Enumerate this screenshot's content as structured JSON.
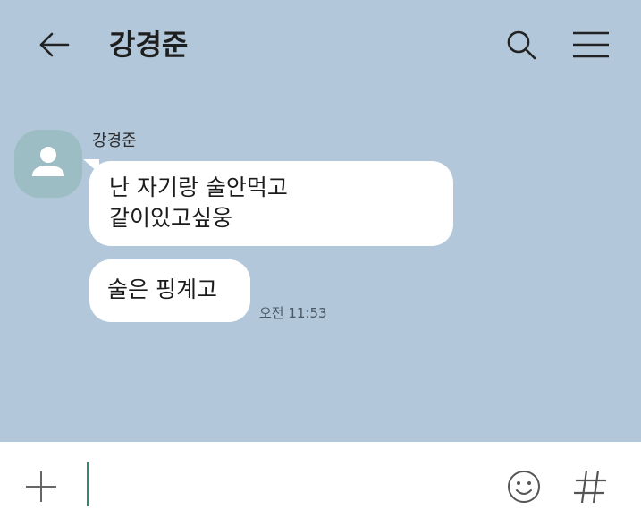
{
  "header": {
    "title": "강경준",
    "back_icon": "arrow-left-icon",
    "search_icon": "search-icon",
    "menu_icon": "hamburger-menu-icon"
  },
  "chat": {
    "sender_name": "강경준",
    "messages": [
      {
        "lines": [
          "난 자기랑 술안먹고",
          "같이있고싶웅"
        ]
      },
      {
        "lines": [
          "술은 핑계고"
        ]
      }
    ],
    "timestamp": "오전 11:53"
  },
  "input_bar": {
    "plus_icon": "plus-icon",
    "emoji_icon": "emoji-icon",
    "hashtag_icon": "hashtag-icon"
  },
  "colors": {
    "chat_background": "#b2c7da",
    "bubble": "#ffffff",
    "avatar": "#9cbdc3",
    "cursor": "#2e8b72"
  }
}
